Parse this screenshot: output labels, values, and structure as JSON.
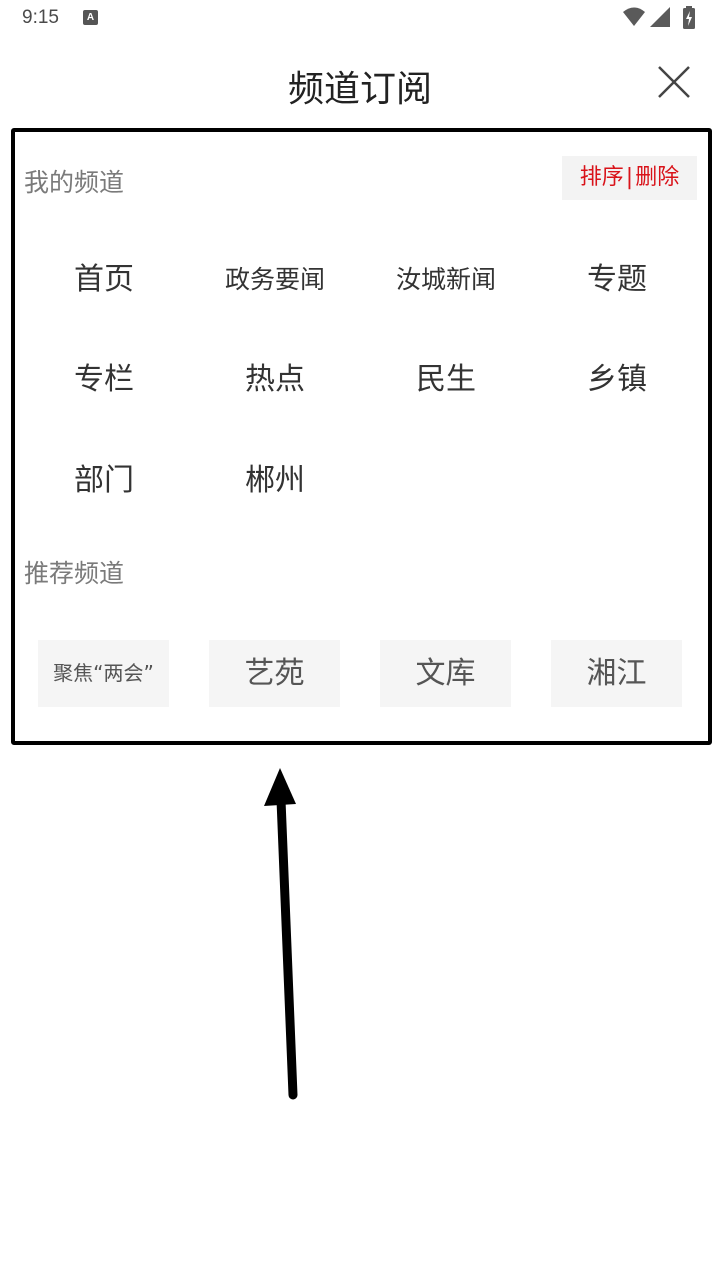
{
  "status_bar": {
    "time": "9:15",
    "notification_icon": "A"
  },
  "header": {
    "title": "频道订阅"
  },
  "my_channels": {
    "label": "我的频道",
    "sort_label": "排序",
    "separator": "|",
    "delete_label": "删除",
    "items": [
      "首页",
      "政务要闻",
      "汝城新闻",
      "专题",
      "专栏",
      "热点",
      "民生",
      "乡镇",
      "部门",
      "郴州"
    ]
  },
  "recommended": {
    "label": "推荐频道",
    "items": [
      "聚焦“两会”",
      "艺苑",
      "文库",
      "湘江"
    ]
  },
  "colors": {
    "accent": "#d9131a",
    "text": "#333333",
    "muted": "#7a7a7a",
    "chip_bg": "#f5f5f5"
  },
  "icons": {
    "close": "close-icon",
    "wifi": "wifi-icon",
    "signal": "signal-icon",
    "battery": "battery-icon"
  }
}
